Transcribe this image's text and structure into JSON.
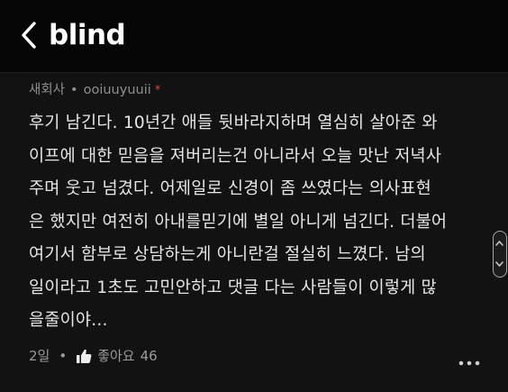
{
  "header": {
    "logo_text": "blind",
    "back_icon": "chevron-left-icon"
  },
  "comment": {
    "company": "새회사",
    "separator": "•",
    "username": "ooiuuyuuii",
    "author_marker": "*",
    "body_lines": [
      "후기 남긴다. 10년간 애들 뒷바라지하며 열심히 살아준 와",
      "이프에 대한 믿음을 져버리는건 아니라서 오늘 맛난 저녁사",
      "주며 웃고 넘겼다. 어제일로 신경이 좀 쓰였다는 의사표현",
      "은 했지만 여전히 아내를믿기에 별일 아니게 넘긴다. 더불어",
      "여기서 함부로 상담하는게 아니란걸 절실히 느꼈다. 남의",
      "일이라고 1초도 고민안하고 댓글 다는 사람들이 이렇게 많",
      "을줄이야..."
    ],
    "time_ago": "2일",
    "like_label": "좋아요",
    "like_count": "46",
    "like_icon": "thumbs-up-icon",
    "more_icon": "more-horizontal-icon"
  },
  "colors": {
    "background": "#121212",
    "text": "#e6e6e6",
    "meta": "#8f8f8f",
    "author_marker": "#e0473a"
  }
}
